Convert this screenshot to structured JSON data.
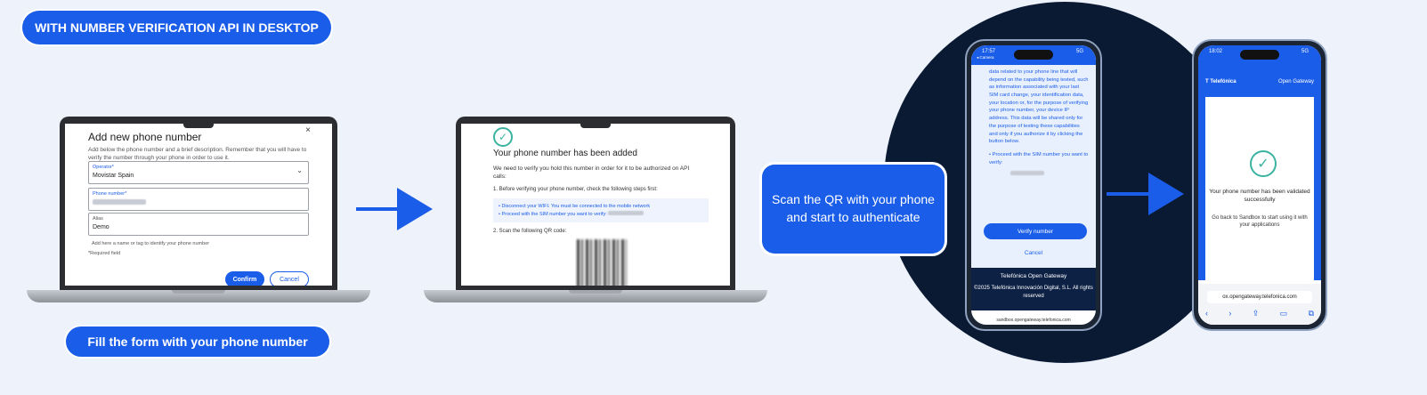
{
  "header": {
    "title": "WITH NUMBER VERIFICATION API IN DESKTOP"
  },
  "step1": {
    "caption": "Fill the form with your phone number",
    "form": {
      "title": "Add new phone number",
      "close": "×",
      "description": "Add below the phone number and a brief description. Remember that you will have to verify the number through your phone in order to use it.",
      "operator_label": "Operator*",
      "operator_value": "Movistar Spain",
      "phone_label": "Phone number*",
      "alias_label": "Alias",
      "alias_value": "Demo",
      "alias_hint": "Add here a name or tag to identify your phone number",
      "required_note": "*Required field",
      "confirm": "Confirm",
      "cancel": "Cancel"
    }
  },
  "step2": {
    "title": "Your phone number has been added",
    "text": "We need to verify you hold this number in order for it to be authorized on API calls:",
    "step1": "1. Before verifying your phone number, check the following steps first:",
    "bullet1": "• Disconnect your WIFI. You must be connected to the mobile network",
    "bullet2": "• Proceed with the SIM number you want to verify:",
    "step2": "2. Scan the following QR code:"
  },
  "scan": {
    "line1": "Scan the QR with your phone",
    "line2": "and start to authenticate"
  },
  "phone1": {
    "time": "17:57",
    "carrier": "◂ Camera",
    "signal": "5G",
    "body": "data related to your phone line that will depend on the capability being tested, such as information associated with your last SIM card change, your identification data, your location or, for the purpose of verifying your phone number, your device IP address. This data will be shared only for the purpose of testing these capabilities and only if you authorize it by clicking the button below.",
    "proceed": "• Proceed with the SIM number you want to verify:",
    "verify_button": "Verify number",
    "cancel": "Cancel",
    "footer_title": "Telefónica Open Gateway",
    "footer_copy": "©2025 Telefónica Innovación Digital, S.L. All rights reserved",
    "url": "sandbox.opengateway.telefonica.com"
  },
  "phone2": {
    "time": "18:02",
    "signal": "5G",
    "brand": "Telefónica",
    "header_right": "Open Gateway",
    "success": "Your phone number has been validated successfully",
    "back": "Go back to Sandbox to start using it with your applications",
    "url": "ox.opengateway.telefonica.com"
  },
  "colors": {
    "accent": "#1a5de8",
    "dark": "#0a1a33",
    "success": "#3bb3a0",
    "background": "#eef2fb"
  }
}
